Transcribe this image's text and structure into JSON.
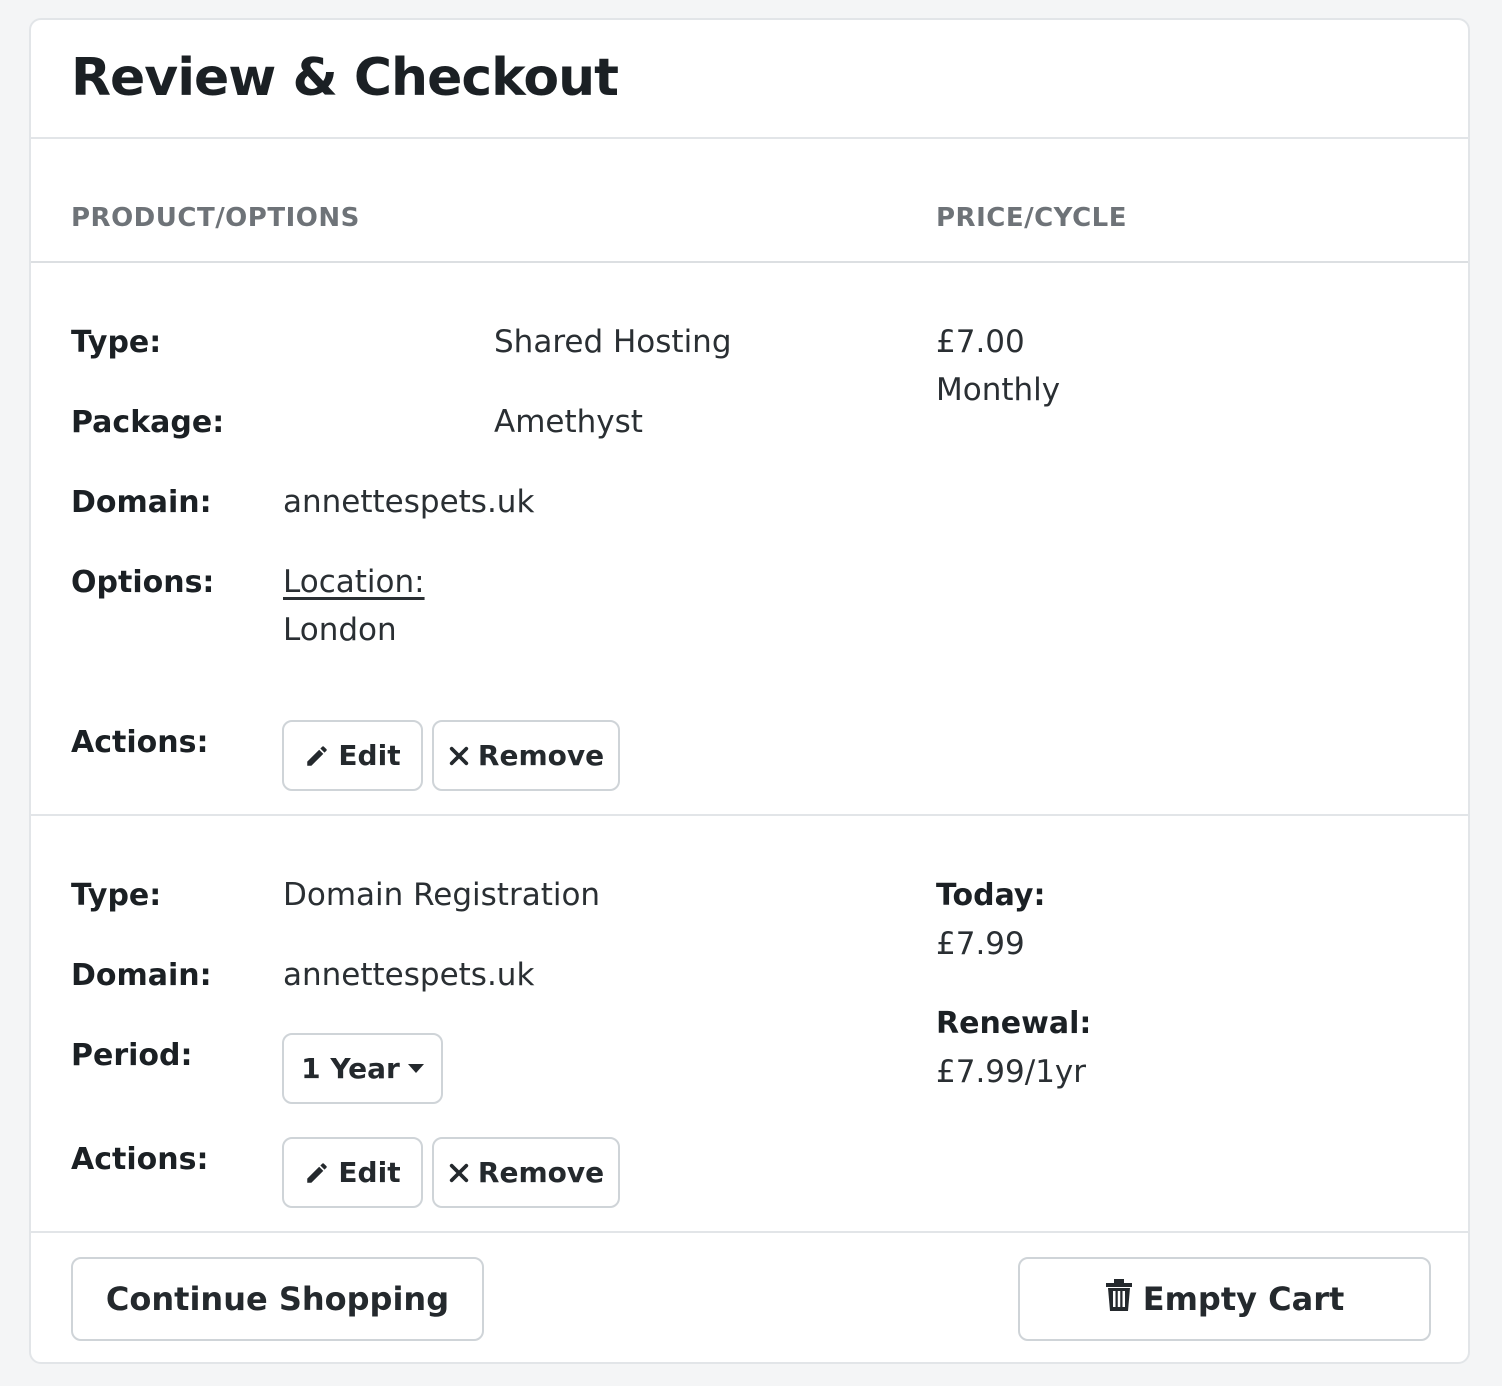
{
  "header": {
    "title": "Review & Checkout"
  },
  "table": {
    "col_product": "PRODUCT/OPTIONS",
    "col_price": "PRICE/CYCLE"
  },
  "items": [
    {
      "type_label": "Type:",
      "type_value": "Shared Hosting",
      "package_label": "Package:",
      "package_value": "Amethyst",
      "domain_label": "Domain:",
      "domain_value": "annettespets.uk",
      "options_label": "Options:",
      "option_name": "Location:",
      "option_value": "London",
      "actions_label": "Actions:",
      "edit_label": "Edit",
      "remove_label": "Remove",
      "price": "£7.00",
      "cycle": "Monthly"
    },
    {
      "type_label": "Type:",
      "type_value": "Domain Registration",
      "domain_label": "Domain:",
      "domain_value": "annettespets.uk",
      "period_label": "Period:",
      "period_value": "1 Year",
      "actions_label": "Actions:",
      "edit_label": "Edit",
      "remove_label": "Remove",
      "today_label": "Today:",
      "today_price": "£7.99",
      "renewal_label": "Renewal:",
      "renewal_price": "£7.99/1yr"
    }
  ],
  "footer": {
    "continue_label": "Continue Shopping",
    "empty_label": "Empty Cart"
  },
  "icons": {
    "edit": "pencil-icon",
    "remove": "x-icon",
    "dropdown": "caret-down-icon",
    "empty": "trash-icon"
  }
}
